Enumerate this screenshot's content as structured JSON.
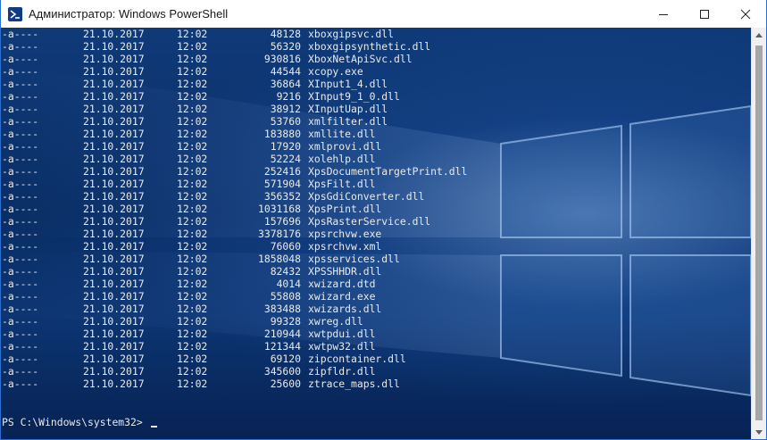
{
  "window": {
    "title": "Администратор: Windows PowerShell",
    "controls": {
      "minimize": "minimize",
      "maximize": "maximize",
      "close": "close"
    }
  },
  "console": {
    "rows": [
      {
        "mode": "-a----",
        "date": "21.10.2017",
        "time": "12:02",
        "length": "48128",
        "name": "xboxgipsvc.dll"
      },
      {
        "mode": "-a----",
        "date": "21.10.2017",
        "time": "12:02",
        "length": "56320",
        "name": "xboxgipsynthetic.dll"
      },
      {
        "mode": "-a----",
        "date": "21.10.2017",
        "time": "12:02",
        "length": "930816",
        "name": "XboxNetApiSvc.dll"
      },
      {
        "mode": "-a----",
        "date": "21.10.2017",
        "time": "12:02",
        "length": "44544",
        "name": "xcopy.exe"
      },
      {
        "mode": "-a----",
        "date": "21.10.2017",
        "time": "12:02",
        "length": "36864",
        "name": "XInput1_4.dll"
      },
      {
        "mode": "-a----",
        "date": "21.10.2017",
        "time": "12:02",
        "length": "9216",
        "name": "XInput9_1_0.dll"
      },
      {
        "mode": "-a----",
        "date": "21.10.2017",
        "time": "12:02",
        "length": "38912",
        "name": "XInputUap.dll"
      },
      {
        "mode": "-a----",
        "date": "21.10.2017",
        "time": "12:02",
        "length": "53760",
        "name": "xmlfilter.dll"
      },
      {
        "mode": "-a----",
        "date": "21.10.2017",
        "time": "12:02",
        "length": "183880",
        "name": "xmllite.dll"
      },
      {
        "mode": "-a----",
        "date": "21.10.2017",
        "time": "12:02",
        "length": "17920",
        "name": "xmlprovi.dll"
      },
      {
        "mode": "-a----",
        "date": "21.10.2017",
        "time": "12:02",
        "length": "52224",
        "name": "xolehlp.dll"
      },
      {
        "mode": "-a----",
        "date": "21.10.2017",
        "time": "12:02",
        "length": "252416",
        "name": "XpsDocumentTargetPrint.dll"
      },
      {
        "mode": "-a----",
        "date": "21.10.2017",
        "time": "12:02",
        "length": "571904",
        "name": "XpsFilt.dll"
      },
      {
        "mode": "-a----",
        "date": "21.10.2017",
        "time": "12:02",
        "length": "356352",
        "name": "XpsGdiConverter.dll"
      },
      {
        "mode": "-a----",
        "date": "21.10.2017",
        "time": "12:02",
        "length": "1031168",
        "name": "XpsPrint.dll"
      },
      {
        "mode": "-a----",
        "date": "21.10.2017",
        "time": "12:02",
        "length": "157696",
        "name": "XpsRasterService.dll"
      },
      {
        "mode": "-a----",
        "date": "21.10.2017",
        "time": "12:02",
        "length": "3378176",
        "name": "xpsrchvw.exe"
      },
      {
        "mode": "-a----",
        "date": "21.10.2017",
        "time": "12:02",
        "length": "76060",
        "name": "xpsrchvw.xml"
      },
      {
        "mode": "-a----",
        "date": "21.10.2017",
        "time": "12:02",
        "length": "1858048",
        "name": "xpsservices.dll"
      },
      {
        "mode": "-a----",
        "date": "21.10.2017",
        "time": "12:02",
        "length": "82432",
        "name": "XPSSHHDR.dll"
      },
      {
        "mode": "-a----",
        "date": "21.10.2017",
        "time": "12:02",
        "length": "4014",
        "name": "xwizard.dtd"
      },
      {
        "mode": "-a----",
        "date": "21.10.2017",
        "time": "12:02",
        "length": "55808",
        "name": "xwizard.exe"
      },
      {
        "mode": "-a----",
        "date": "21.10.2017",
        "time": "12:02",
        "length": "383488",
        "name": "xwizards.dll"
      },
      {
        "mode": "-a----",
        "date": "21.10.2017",
        "time": "12:02",
        "length": "99328",
        "name": "xwreg.dll"
      },
      {
        "mode": "-a----",
        "date": "21.10.2017",
        "time": "12:02",
        "length": "210944",
        "name": "xwtpdui.dll"
      },
      {
        "mode": "-a----",
        "date": "21.10.2017",
        "time": "12:02",
        "length": "121344",
        "name": "xwtpw32.dll"
      },
      {
        "mode": "-a----",
        "date": "21.10.2017",
        "time": "12:02",
        "length": "69120",
        "name": "zipcontainer.dll"
      },
      {
        "mode": "-a----",
        "date": "21.10.2017",
        "time": "12:02",
        "length": "345600",
        "name": "zipfldr.dll"
      },
      {
        "mode": "-a----",
        "date": "21.10.2017",
        "time": "12:02",
        "length": "25600",
        "name": "ztrace_maps.dll"
      }
    ],
    "prompt": "PS C:\\Windows\\system32> "
  },
  "icons": {
    "app": "powershell-icon",
    "scroll_up": "chevron-up-icon",
    "scroll_down": "chevron-down-icon"
  },
  "colors": {
    "console_text": "#eaeaea",
    "console_bg": "#0a2e66",
    "titlebar_bg": "#ffffff"
  }
}
